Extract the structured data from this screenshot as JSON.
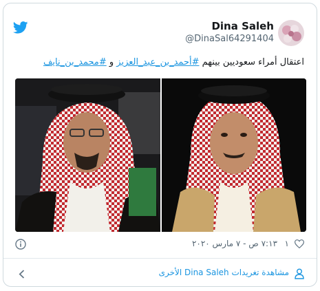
{
  "tweet": {
    "author": {
      "display_name": "Dina Saleh",
      "handle": "@DinaSal64291404"
    },
    "text_prefix": "اعتقال أمراء سعوديين بينهم ",
    "hashtag_1": "#أحمد_بن_عبد_العزيز",
    "connector": " و ",
    "hashtag_2": "#محمد_بن_نايف",
    "timestamp": "٧:١٣ ص - ٧ مارس ٢٠٢٠",
    "likes": "١",
    "more_tweets": "مشاهدة تغريدات Dina Saleh الأخرى"
  },
  "icons": {
    "brand": "twitter-bird-icon",
    "info": "info-icon",
    "like": "heart-icon",
    "profile": "person-icon",
    "navigate": "chevron-left-icon"
  },
  "colors": {
    "twitter_blue": "#1da1f2",
    "link_blue": "#1b95e0",
    "text_primary": "#14171a",
    "text_secondary": "#536471",
    "border": "#cfd9de"
  }
}
